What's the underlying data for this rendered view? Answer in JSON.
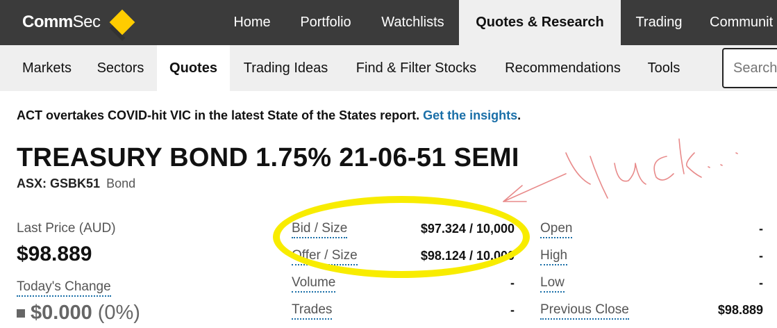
{
  "header": {
    "logo_text_bold": "Comm",
    "logo_text_light": "Sec",
    "nav": [
      {
        "label": "Home"
      },
      {
        "label": "Portfolio"
      },
      {
        "label": "Watchlists"
      },
      {
        "label": "Quotes & Research",
        "active": true
      },
      {
        "label": "Trading"
      },
      {
        "label": "Communit"
      }
    ]
  },
  "subnav": {
    "items": [
      {
        "label": "Markets"
      },
      {
        "label": "Sectors"
      },
      {
        "label": "Quotes",
        "active": true
      },
      {
        "label": "Trading Ideas"
      },
      {
        "label": "Find & Filter Stocks"
      },
      {
        "label": "Recommendations"
      },
      {
        "label": "Tools"
      }
    ],
    "search_placeholder": "Search"
  },
  "banner": {
    "text": "ACT overtakes COVID-hit VIC in the latest State of the States report. ",
    "link": "Get the insights",
    "end": "."
  },
  "security": {
    "name": "TREASURY BOND 1.75% 21-06-51 SEMI",
    "code": "ASX: GSBK51",
    "type": "Bond"
  },
  "price": {
    "last_label": "Last Price (AUD)",
    "last_value": "$98.889",
    "change_label": "Today's Change",
    "change_value": "$0.000",
    "change_pct": "(0%)"
  },
  "quote_left": [
    {
      "label": "Bid / Size",
      "value": "$97.324 / 10,000"
    },
    {
      "label": "Offer / Size",
      "value": "$98.124 / 10,000"
    },
    {
      "label": "Volume",
      "value": "-"
    },
    {
      "label": "Trades",
      "value": "-"
    }
  ],
  "quote_right": [
    {
      "label": "Open",
      "value": "-"
    },
    {
      "label": "High",
      "value": "-"
    },
    {
      "label": "Low",
      "value": "-"
    },
    {
      "label": "Previous Close",
      "value": "$98.889"
    }
  ],
  "colors": {
    "topbar": "#3b3b3b",
    "subbar": "#efefef",
    "accent_link": "#1a6fa8",
    "logo_yellow": "#ffcc00",
    "highlight_yellow": "#f8ec00",
    "scribble_red": "#e88a8a"
  }
}
